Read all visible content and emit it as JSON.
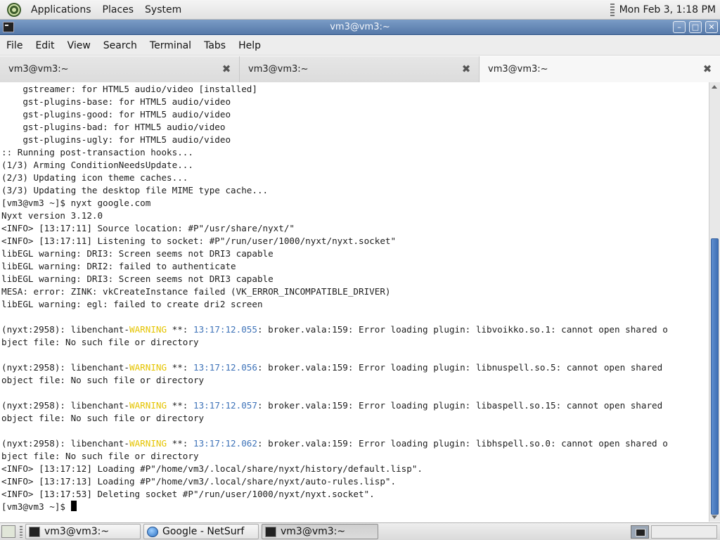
{
  "top_panel": {
    "menus": [
      "Applications",
      "Places",
      "System"
    ],
    "clock": "Mon Feb  3, 1:18 PM"
  },
  "window": {
    "title": "vm3@vm3:~",
    "buttons": [
      "minimize-icon",
      "maximize-icon",
      "close-icon"
    ]
  },
  "menubar": {
    "items": [
      "File",
      "Edit",
      "View",
      "Search",
      "Terminal",
      "Tabs",
      "Help"
    ]
  },
  "tabs": [
    {
      "label": "vm3@vm3:~",
      "active": false
    },
    {
      "label": "vm3@vm3:~",
      "active": false
    },
    {
      "label": "vm3@vm3:~",
      "active": true
    }
  ],
  "terminal": {
    "lines": [
      {
        "parts": [
          {
            "t": "    gstreamer: for HTML5 audio/video [installed]"
          }
        ]
      },
      {
        "parts": [
          {
            "t": "    gst-plugins-base: for HTML5 audio/video"
          }
        ]
      },
      {
        "parts": [
          {
            "t": "    gst-plugins-good: for HTML5 audio/video"
          }
        ]
      },
      {
        "parts": [
          {
            "t": "    gst-plugins-bad: for HTML5 audio/video"
          }
        ]
      },
      {
        "parts": [
          {
            "t": "    gst-plugins-ugly: for HTML5 audio/video"
          }
        ]
      },
      {
        "parts": [
          {
            "t": ":: Running post-transaction hooks..."
          }
        ]
      },
      {
        "parts": [
          {
            "t": "(1/3) Arming ConditionNeedsUpdate..."
          }
        ]
      },
      {
        "parts": [
          {
            "t": "(2/3) Updating icon theme caches..."
          }
        ]
      },
      {
        "parts": [
          {
            "t": "(3/3) Updating the desktop file MIME type cache..."
          }
        ]
      },
      {
        "parts": [
          {
            "t": "[vm3@vm3 ~]$ nyxt google.com"
          }
        ]
      },
      {
        "parts": [
          {
            "t": "Nyxt version 3.12.0"
          }
        ]
      },
      {
        "parts": [
          {
            "t": "<INFO> [13:17:11] Source location: #P\"/usr/share/nyxt/\""
          }
        ]
      },
      {
        "parts": [
          {
            "t": "<INFO> [13:17:11] Listening to socket: #P\"/run/user/1000/nyxt/nyxt.socket\""
          }
        ]
      },
      {
        "parts": [
          {
            "t": "libEGL warning: DRI3: Screen seems not DRI3 capable"
          }
        ]
      },
      {
        "parts": [
          {
            "t": "libEGL warning: DRI2: failed to authenticate"
          }
        ]
      },
      {
        "parts": [
          {
            "t": "libEGL warning: DRI3: Screen seems not DRI3 capable"
          }
        ]
      },
      {
        "parts": [
          {
            "t": "MESA: error: ZINK: vkCreateInstance failed (VK_ERROR_INCOMPATIBLE_DRIVER)"
          }
        ]
      },
      {
        "parts": [
          {
            "t": "libEGL warning: egl: failed to create dri2 screen"
          }
        ]
      },
      {
        "parts": [
          {
            "t": ""
          }
        ]
      },
      {
        "parts": [
          {
            "t": "(nyxt:2958): libenchant-"
          },
          {
            "t": "WARNING",
            "c": "warn"
          },
          {
            "t": " **: "
          },
          {
            "t": "13:17:12.055",
            "c": "ts"
          },
          {
            "t": ": broker.vala:159: Error loading plugin: libvoikko.so.1: cannot open shared o"
          }
        ]
      },
      {
        "parts": [
          {
            "t": "bject file: No such file or directory"
          }
        ]
      },
      {
        "parts": [
          {
            "t": ""
          }
        ]
      },
      {
        "parts": [
          {
            "t": "(nyxt:2958): libenchant-"
          },
          {
            "t": "WARNING",
            "c": "warn"
          },
          {
            "t": " **: "
          },
          {
            "t": "13:17:12.056",
            "c": "ts"
          },
          {
            "t": ": broker.vala:159: Error loading plugin: libnuspell.so.5: cannot open shared"
          }
        ]
      },
      {
        "parts": [
          {
            "t": "object file: No such file or directory"
          }
        ]
      },
      {
        "parts": [
          {
            "t": ""
          }
        ]
      },
      {
        "parts": [
          {
            "t": "(nyxt:2958): libenchant-"
          },
          {
            "t": "WARNING",
            "c": "warn"
          },
          {
            "t": " **: "
          },
          {
            "t": "13:17:12.057",
            "c": "ts"
          },
          {
            "t": ": broker.vala:159: Error loading plugin: libaspell.so.15: cannot open shared"
          }
        ]
      },
      {
        "parts": [
          {
            "t": "object file: No such file or directory"
          }
        ]
      },
      {
        "parts": [
          {
            "t": ""
          }
        ]
      },
      {
        "parts": [
          {
            "t": "(nyxt:2958): libenchant-"
          },
          {
            "t": "WARNING",
            "c": "warn"
          },
          {
            "t": " **: "
          },
          {
            "t": "13:17:12.062",
            "c": "ts"
          },
          {
            "t": ": broker.vala:159: Error loading plugin: libhspell.so.0: cannot open shared o"
          }
        ]
      },
      {
        "parts": [
          {
            "t": "bject file: No such file or directory"
          }
        ]
      },
      {
        "parts": [
          {
            "t": "<INFO> [13:17:12] Loading #P\"/home/vm3/.local/share/nyxt/history/default.lisp\"."
          }
        ]
      },
      {
        "parts": [
          {
            "t": "<INFO> [13:17:13] Loading #P\"/home/vm3/.local/share/nyxt/auto-rules.lisp\"."
          }
        ]
      },
      {
        "parts": [
          {
            "t": "<INFO> [13:17:53] Deleting socket #P\"/run/user/1000/nyxt/nyxt.socket\"."
          }
        ]
      },
      {
        "parts": [
          {
            "t": "[vm3@vm3 ~]$ "
          }
        ],
        "cursor": true
      }
    ]
  },
  "taskbar": {
    "tasks": [
      {
        "label": "vm3@vm3:~",
        "icon": "terminal-icon",
        "pressed": false
      },
      {
        "label": "Google - NetSurf",
        "icon": "netsurf-globe-icon",
        "pressed": false
      },
      {
        "label": "vm3@vm3:~",
        "icon": "terminal-icon",
        "pressed": true
      }
    ]
  },
  "colors": {
    "warning": "#e5c400",
    "timestamp": "#3d72b8",
    "titlebar": "#6184b3",
    "scroll_thumb": "#4f7fc2"
  }
}
